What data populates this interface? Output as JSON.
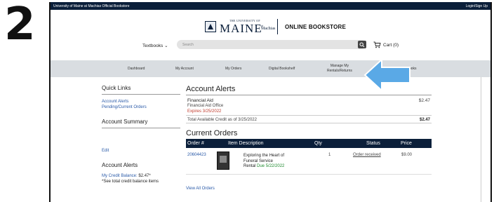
{
  "step": "2",
  "topbar": {
    "title": "University of Maine at Machias Official Bookstore",
    "login": "Login/Sign Up"
  },
  "brand": {
    "uni_small": "THE UNIVERSITY OF",
    "uni_big": "MAINE",
    "at": "at",
    "campus": "Machias",
    "store": "ONLINE BOOKSTORE"
  },
  "header": {
    "textbooks": "Textbooks",
    "search_placeholder": "Search",
    "cart": "Cart (0)"
  },
  "nav": {
    "items": [
      "Dashboard",
      "My Account",
      "My Orders",
      "Digital Bookshelf",
      "Manage My",
      "Rentals/Returns",
      "ooks"
    ]
  },
  "sidebar": {
    "quick_links_heading": "Quick Links",
    "links": [
      "Account Alerts",
      "Pending/Current Orders"
    ],
    "summary_heading": "Account Summary",
    "edit": "Edit",
    "alerts_heading": "Account Alerts",
    "credit_label": "My Credit Balance:",
    "credit_value": "$2.47*",
    "credit_note": "*See total credit balance items"
  },
  "alerts": {
    "heading": "Account Alerts",
    "title": "Financial Aid",
    "office": "Financial Aid Office",
    "expires": "Expires 3/25/2022",
    "amount": "$2.47",
    "credit_label": "Total Available Credit as of 3/25/2022",
    "credit_amount": "$2.47"
  },
  "orders": {
    "heading": "Current Orders",
    "columns": [
      "Order #",
      "Item Description",
      "Qty",
      "Status",
      "Price"
    ],
    "row": {
      "order_number": "20604423",
      "description": "Exploring the Heart of Funeral Service",
      "rental": "Rental",
      "due": "Due 5/22/2022",
      "qty": "1",
      "status": "Order received",
      "price": "$9.00"
    },
    "view_all": "View All Orders"
  },
  "colors": {
    "navy": "#0b1f3a",
    "arrow": "#5aa9e6",
    "link": "#2a5aa8",
    "due_green": "#1e8a2e",
    "expires_red": "#c0392b"
  }
}
